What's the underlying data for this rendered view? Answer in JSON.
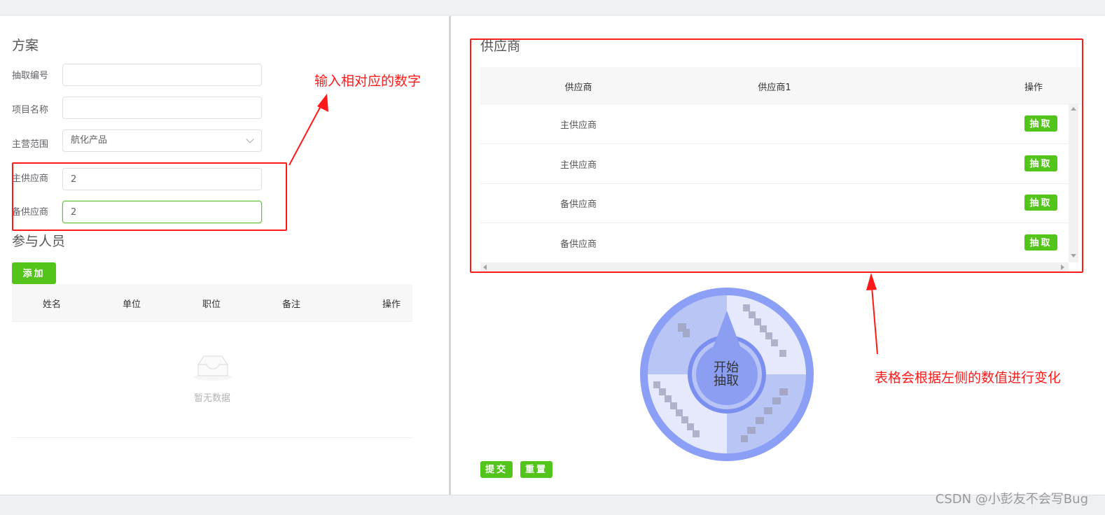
{
  "plan": {
    "title": "方案",
    "fields": [
      {
        "label": "抽取编号",
        "value": ""
      },
      {
        "label": "项目名称",
        "value": ""
      },
      {
        "label": "主营范围",
        "value": "航化产品"
      },
      {
        "label": "主供应商",
        "value": "2"
      },
      {
        "label": "备供应商",
        "value": "2"
      }
    ]
  },
  "participants": {
    "title": "参与人员",
    "add_label": "添加",
    "columns": [
      "姓名",
      "单位",
      "职位",
      "备注",
      "操作"
    ],
    "empty_text": "暂无数据"
  },
  "supplier": {
    "title": "供应商",
    "columns": [
      "供应商",
      "供应商1",
      "操作"
    ],
    "rows": [
      {
        "type": "主供应商",
        "action": "抽取"
      },
      {
        "type": "主供应商",
        "action": "抽取"
      },
      {
        "type": "备供应商",
        "action": "抽取"
      },
      {
        "type": "备供应商",
        "action": "抽取"
      }
    ]
  },
  "wheel": {
    "center_line1": "开始",
    "center_line2": "抽取",
    "colors": {
      "outer": "#8a9ff5",
      "center": "#7b8ff0"
    }
  },
  "footer": {
    "submit_label": "提交",
    "reset_label": "重置"
  },
  "annotations": {
    "input_note": "输入相对应的数字",
    "table_note": "表格会根据左侧的数值进行变化",
    "color": "#ff1a1a"
  },
  "watermark": "CSDN @小彭友不会写Bug"
}
